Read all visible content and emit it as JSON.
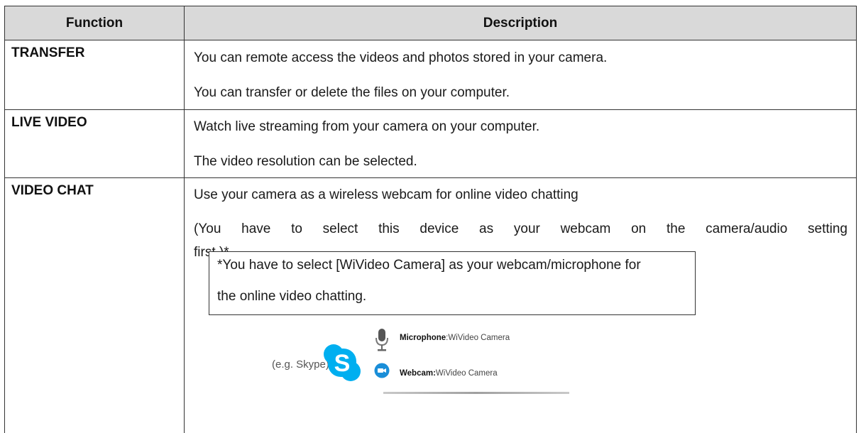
{
  "header": {
    "function": "Function",
    "description": "Description"
  },
  "rows": [
    {
      "function": "TRANSFER",
      "lines": [
        "You can remote access the videos and photos stored in your camera.",
        "You can transfer or delete the files on your computer."
      ]
    },
    {
      "function": "LIVE VIDEO",
      "lines": [
        "Watch live streaming from your camera on your computer.",
        "The video resolution can be selected."
      ]
    },
    {
      "function": "VIDEO CHAT",
      "lines": [
        "Use your camera as a wireless webcam for online video chatting",
        "(You have to select this device as your webcam on the camera/audio setting",
        "first.)*"
      ],
      "note": {
        "line1": "*You have to select [WiVideo Camera] as your webcam/microphone  for",
        "line2": "the online video chatting."
      },
      "example": {
        "label": "(e.g. Skype)",
        "microphone_label": "Microphone",
        "microphone_value": "WiVideo Camera",
        "webcam_label": "Webcam:",
        "webcam_value": "WiVideo Camera",
        "skype_color": "#00aff0"
      }
    }
  ]
}
